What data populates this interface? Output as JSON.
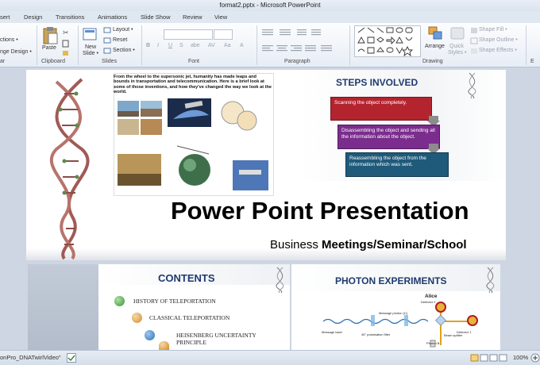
{
  "window": {
    "title": "format2.pptx - Microsoft PowerPoint"
  },
  "tabs": [
    "sert",
    "Design",
    "Transitions",
    "Animations",
    "Slide Show",
    "Review",
    "View"
  ],
  "ribbon": {
    "left_items": [
      "ctions •",
      "nge Design •"
    ],
    "clipboard": {
      "paste": "Paste",
      "label": "Clipboard"
    },
    "slides": {
      "new_slide": "New",
      "new_slide2": "Slide •",
      "layout": "Layout •",
      "reset": "Reset",
      "section": "Section •",
      "label": "Slides"
    },
    "font": {
      "label": "Font",
      "bold": "B",
      "italic": "I",
      "underline": "U",
      "strike": "S",
      "shadow": "abe",
      "spacing": "AV",
      "case": "Aa",
      "color": "A"
    },
    "paragraph": {
      "label": "Paragraph"
    },
    "drawing": {
      "arrange": "Arrange",
      "quick_styles": "Quick",
      "quick_styles2": "Styles •",
      "shape_fill": "Shape Fill •",
      "shape_outline": "Shape Outline •",
      "shape_effects": "Shape Effects •",
      "label": "Drawing"
    },
    "edge_label": "E",
    "left_group_label": "ar"
  },
  "slide1": {
    "intro_text": "From the wheel to the supersonic jet, humanity has made leaps and bounds in transportation and telecommunication. Here is a brief look at some of those inventions, and how they've changed the way we look at the world.",
    "steps_title": "STEPS INVOLVED",
    "steps": [
      "Scanning the object completely.",
      "Disassembling the object and sending  all the information about the object.",
      "Reassembling the object from the information which was sent."
    ],
    "title": "Power Point Presentation",
    "subtitle_prefix": "Business ",
    "subtitle_bold": "Meetings/Seminar/School",
    "colors": {
      "step1": "#b3242f",
      "step2": "#7b2d8e",
      "step3": "#1f5a7a",
      "title_text": "#000000",
      "heading": "#1f3a6e"
    }
  },
  "slide2": {
    "title": "CONTENTS",
    "items": [
      "HISTORY OF TELEPORTATION",
      "CLASSICAL TELEPORTATION",
      "HEISENBERG UNCERTAINTY PRINCIPLE"
    ],
    "bullet_colors": [
      "#3f8f3a",
      "#d48a2c",
      "#2f6fb3",
      "#d48a2c"
    ]
  },
  "slide3": {
    "title": "PHOTON EXPERIMENTS",
    "labels": {
      "alice": "Alice",
      "detector2": "Detector 2",
      "detector1": "Detector 1",
      "message_photon": "Message photon (C)",
      "message_laser": "Message laser",
      "polarisation": "45° polarisation filter",
      "beam_splitter": "Beam splitter",
      "photon_b": "Photon B"
    }
  },
  "status": {
    "left_text": "onPro_DNATwirlVideo\"",
    "zoom": "100%"
  }
}
